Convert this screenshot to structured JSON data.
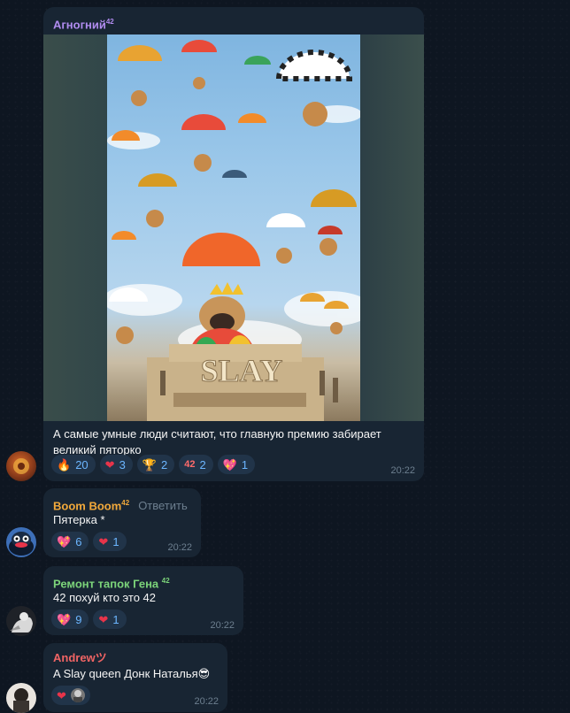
{
  "messages": [
    {
      "author": "Агногний",
      "badge": "42",
      "author_color": "#b18cf0",
      "text": "А самые умные люди считают, что главную премию забирает великий пяторко",
      "image": {
        "banner_text": "SLAY"
      },
      "reactions": [
        {
          "emoji": "🔥",
          "count": "20"
        },
        {
          "emoji": "❤",
          "count": "3"
        },
        {
          "emoji": "🏆",
          "count": "2"
        },
        {
          "emoji": "42",
          "count": "2"
        },
        {
          "emoji": "💖",
          "count": "1"
        }
      ],
      "time": "20:22"
    },
    {
      "author": "Boom Boom",
      "badge": "42",
      "author_color": "#f2a93b",
      "reply_label": "Ответить",
      "text": "Пятерка *",
      "reactions": [
        {
          "emoji": "💖",
          "count": "6"
        },
        {
          "emoji": "❤",
          "count": "1"
        }
      ],
      "time": "20:22"
    },
    {
      "author": "Ремонт тапок Гена",
      "badge": "42",
      "author_color": "#7cd47a",
      "text": "42 похуй кто это 42",
      "reactions": [
        {
          "emoji": "💖",
          "count": "9"
        },
        {
          "emoji": "❤",
          "count": "1"
        }
      ],
      "time": "20:22"
    },
    {
      "author": "Andrewツ",
      "author_color": "#f06464",
      "text": "A Slay queen Донк Наталья😎",
      "reactions": [
        {
          "emoji": "❤",
          "count": ""
        }
      ],
      "time": "20:22"
    }
  ]
}
